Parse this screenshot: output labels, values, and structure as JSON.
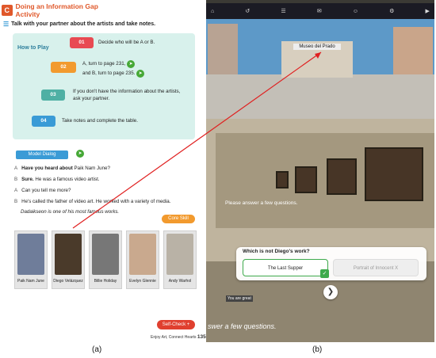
{
  "header": {
    "badge": "C",
    "title": "Doing an Information Gap Activity"
  },
  "instruction": "Talk with your partner about the artists and take notes.",
  "how_to_play": {
    "title": "How to Play",
    "steps": [
      {
        "num": "01",
        "color": "#e84a52",
        "text": "Decide who will be A or B."
      },
      {
        "num": "02",
        "color": "#f29a2e",
        "text": "A, turn to page 231,",
        "text2": "and B, turn to page 235."
      },
      {
        "num": "03",
        "color": "#4fb0a4",
        "text": "If you don't have the information about the artists,",
        "text2": "ask your partner."
      },
      {
        "num": "04",
        "color": "#3a9bd6",
        "text": "Take notes and complete the table."
      }
    ]
  },
  "model_dialog": {
    "label": "Model Dialog",
    "lines": [
      {
        "speaker": "A",
        "bold": "Have you heard about",
        "rest": " Paik Nam June?"
      },
      {
        "speaker": "B",
        "bold": "Sure.",
        "rest": " He was a famous video artist."
      },
      {
        "speaker": "A",
        "bold": "",
        "rest": "Can you tell me more?"
      },
      {
        "speaker": "B",
        "bold": "",
        "rest": "He's called the father of video art. He worked with a variety of media."
      },
      {
        "speaker": "",
        "bold": "",
        "rest": "Dadaikseon is one of his most famous works."
      }
    ]
  },
  "core_skill": "Core Skill",
  "artists": [
    {
      "name": "Paik Nam June",
      "color": "#6f7d9a"
    },
    {
      "name": "Diego Velázquez",
      "color": "#4a3a2a"
    },
    {
      "name": "Billie Holiday",
      "color": "#777777"
    },
    {
      "name": "Evelyn Glennie",
      "color": "#c9a98e"
    },
    {
      "name": "Andy Warhol",
      "color": "#b9b2a6"
    }
  ],
  "self_check": "Self-Check +",
  "footer": {
    "text": "Enjoy Art, Connect Hearts",
    "page": "135"
  },
  "vr": {
    "museum_sign": "Museo del Prado",
    "prompt": "Please answer a few questions.",
    "question": "Which is not Diego's work?",
    "options": [
      "The Last Supper",
      "Portrait of Innocent X"
    ],
    "next_icon": "chevron-right-icon",
    "great": "You are great",
    "bottom_text": "swer a few questions."
  },
  "captions": {
    "a": "(a)",
    "b": "(b)"
  }
}
